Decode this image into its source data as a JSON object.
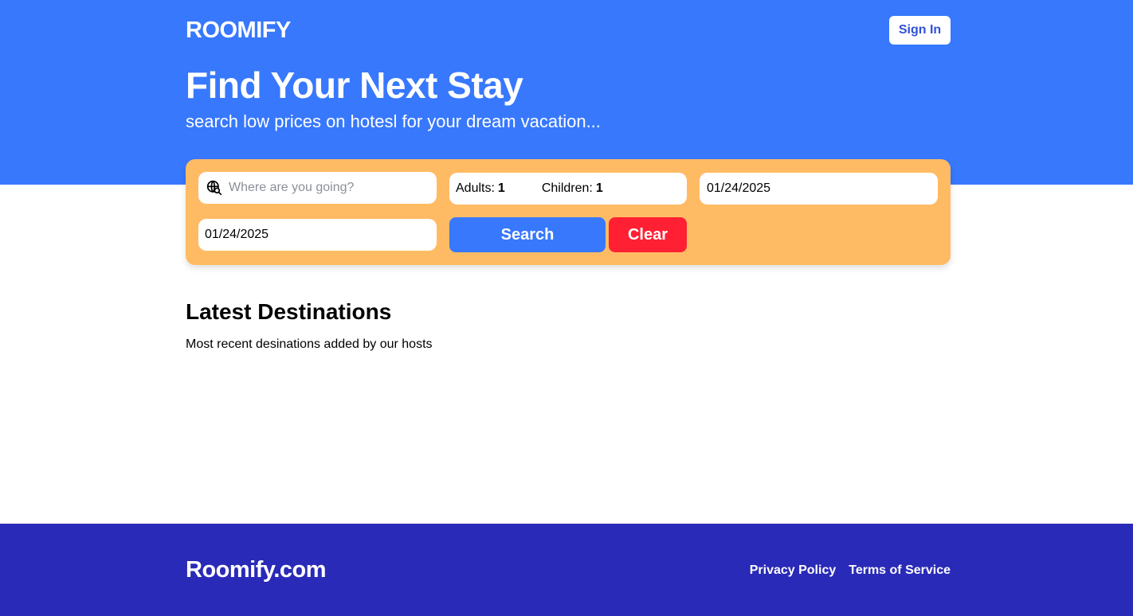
{
  "header": {
    "brand": "ROOMIFY",
    "sign_in_label": "Sign In"
  },
  "hero": {
    "title": "Find Your Next Stay",
    "subtitle": "search low prices on hotesl for your dream vacation..."
  },
  "search": {
    "destination_placeholder": "Where are you going?",
    "destination_value": "",
    "adults_label": "Adults:",
    "adults_value": "1",
    "children_label": "Children:",
    "children_value": "1",
    "check_in": "01/24/2025",
    "check_out": "01/24/2025",
    "search_label": "Search",
    "clear_label": "Clear",
    "icon": "globe-search-icon"
  },
  "latest": {
    "title": "Latest Destinations",
    "subtitle": "Most recent desinations added by our hosts"
  },
  "footer": {
    "brand": "Roomify.com",
    "links": [
      "Privacy Policy",
      "Terms of Service"
    ]
  },
  "colors": {
    "primary": "#3778fd",
    "search_panel": "#ffbb64",
    "clear": "#ff2033",
    "footer": "#2a2ab8"
  }
}
